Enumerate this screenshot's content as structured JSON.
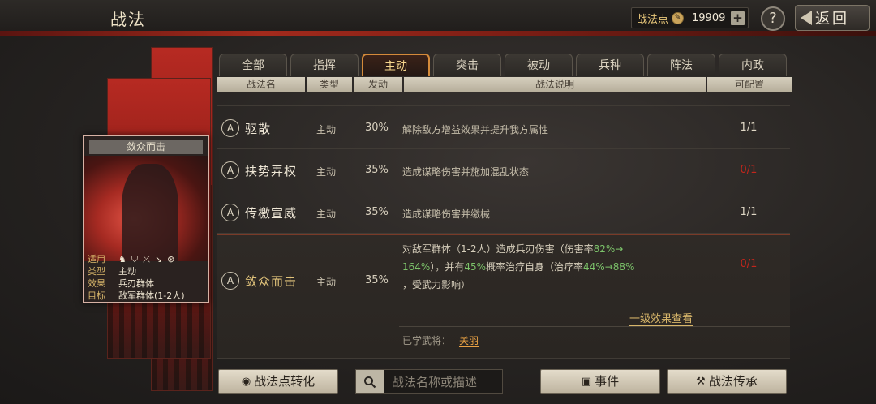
{
  "header": {
    "title": "战法",
    "points_label": "战法点",
    "points_value": "19909",
    "plus_label": "+",
    "help_label": "?",
    "back_label": "返回"
  },
  "card": {
    "title": "敛众而击",
    "rows": [
      {
        "key": "适用",
        "value": ""
      },
      {
        "key": "类型",
        "value": "主动"
      },
      {
        "key": "效果",
        "value": "兵刃群体"
      },
      {
        "key": "目标",
        "value": "敌军群体(1-2人)"
      }
    ],
    "icons": [
      "cavalry-icon",
      "shield-icon",
      "bow-icon",
      "spear-icon",
      "wheel-icon"
    ]
  },
  "tabs": [
    {
      "label": "全部",
      "active": false
    },
    {
      "label": "指挥",
      "active": false
    },
    {
      "label": "主动",
      "active": true
    },
    {
      "label": "突击",
      "active": false
    },
    {
      "label": "被动",
      "active": false
    },
    {
      "label": "兵种",
      "active": false
    },
    {
      "label": "阵法",
      "active": false
    },
    {
      "label": "内政",
      "active": false
    }
  ],
  "columns": {
    "name": "战法名",
    "type": "类型",
    "trigger": "发动",
    "desc": "战法说明",
    "config": "可配置"
  },
  "rows": [
    {
      "grade": "A",
      "name": "驱散",
      "type": "主动",
      "pct": "30%",
      "desc": "解除敌方增益效果并提升我方属性",
      "count": "1/1",
      "count_red": false
    },
    {
      "grade": "A",
      "name": "挟势弄权",
      "type": "主动",
      "pct": "35%",
      "desc": "造成谋略伤害并施加混乱状态",
      "count": "0/1",
      "count_red": true
    },
    {
      "grade": "A",
      "name": "传檄宣威",
      "type": "主动",
      "pct": "35%",
      "desc": "造成谋略伤害并缴械",
      "count": "1/1",
      "count_red": false
    }
  ],
  "expanded": {
    "grade": "A",
    "name": "敛众而击",
    "type": "主动",
    "pct": "35%",
    "count": "0/1",
    "desc_1": "对敌军群体（1-2人）造成兵刃伤害（伤害率",
    "desc_g1": "82%→",
    "desc_g2": "164%",
    "desc_2": "），并有",
    "desc_g3": "45%",
    "desc_3": "概率治疗自身（治疗率",
    "desc_g4": "44%",
    "desc_g5": "→88%",
    "desc_4": "，受武力影响）",
    "effect_link": "一级效果查看",
    "learned_label": "已学武将：",
    "learned_name": "关羽"
  },
  "bottom": {
    "convert_label": "战法点转化",
    "search_placeholder": "战法名称或描述",
    "event_label": "事件",
    "inherit_label": "战法传承"
  }
}
